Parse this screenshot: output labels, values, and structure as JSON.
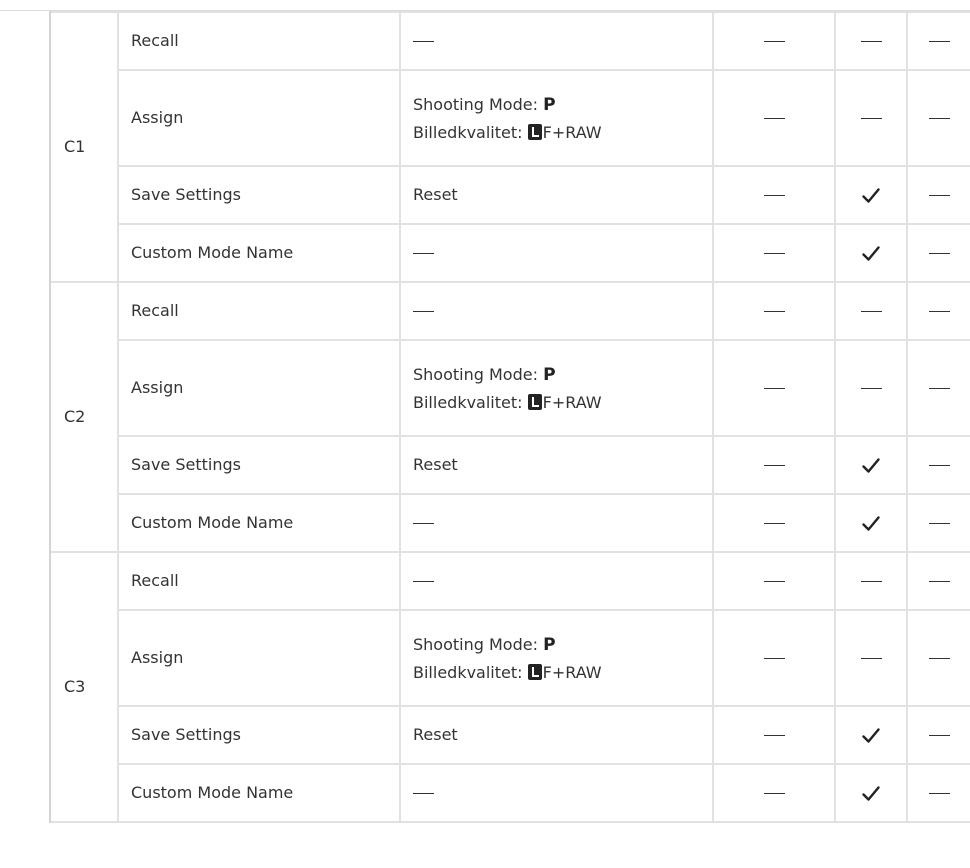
{
  "groups": [
    {
      "mode": "C1",
      "rows": [
        {
          "func": "Recall",
          "default": "—",
          "marks": [
            "—",
            "—",
            "—"
          ]
        },
        {
          "func": "Assign",
          "default": {
            "shooting_label": "Shooting Mode:",
            "shooting_value": "P",
            "quality_label": "Billedkvalitet:",
            "quality_icon": "L",
            "quality_value": "F+RAW"
          },
          "marks": [
            "—",
            "—",
            "—"
          ]
        },
        {
          "func": "Save Settings",
          "default": "Reset",
          "marks": [
            "—",
            "✓",
            "—"
          ]
        },
        {
          "func": "Custom Mode Name",
          "default": "—",
          "marks": [
            "—",
            "✓",
            "—"
          ]
        }
      ]
    },
    {
      "mode": "C2",
      "rows": [
        {
          "func": "Recall",
          "default": "—",
          "marks": [
            "—",
            "—",
            "—"
          ]
        },
        {
          "func": "Assign",
          "default": {
            "shooting_label": "Shooting Mode:",
            "shooting_value": "P",
            "quality_label": "Billedkvalitet:",
            "quality_icon": "L",
            "quality_value": "F+RAW"
          },
          "marks": [
            "—",
            "—",
            "—"
          ]
        },
        {
          "func": "Save Settings",
          "default": "Reset",
          "marks": [
            "—",
            "✓",
            "—"
          ]
        },
        {
          "func": "Custom Mode Name",
          "default": "—",
          "marks": [
            "—",
            "✓",
            "—"
          ]
        }
      ]
    },
    {
      "mode": "C3",
      "rows": [
        {
          "func": "Recall",
          "default": "—",
          "marks": [
            "—",
            "—",
            "—"
          ]
        },
        {
          "func": "Assign",
          "default": {
            "shooting_label": "Shooting Mode:",
            "shooting_value": "P",
            "quality_label": "Billedkvalitet:",
            "quality_icon": "L",
            "quality_value": "F+RAW"
          },
          "marks": [
            "—",
            "—",
            "—"
          ]
        },
        {
          "func": "Save Settings",
          "default": "Reset",
          "marks": [
            "—",
            "✓",
            "—"
          ]
        },
        {
          "func": "Custom Mode Name",
          "default": "—",
          "marks": [
            "—",
            "✓",
            "—"
          ]
        }
      ]
    }
  ]
}
